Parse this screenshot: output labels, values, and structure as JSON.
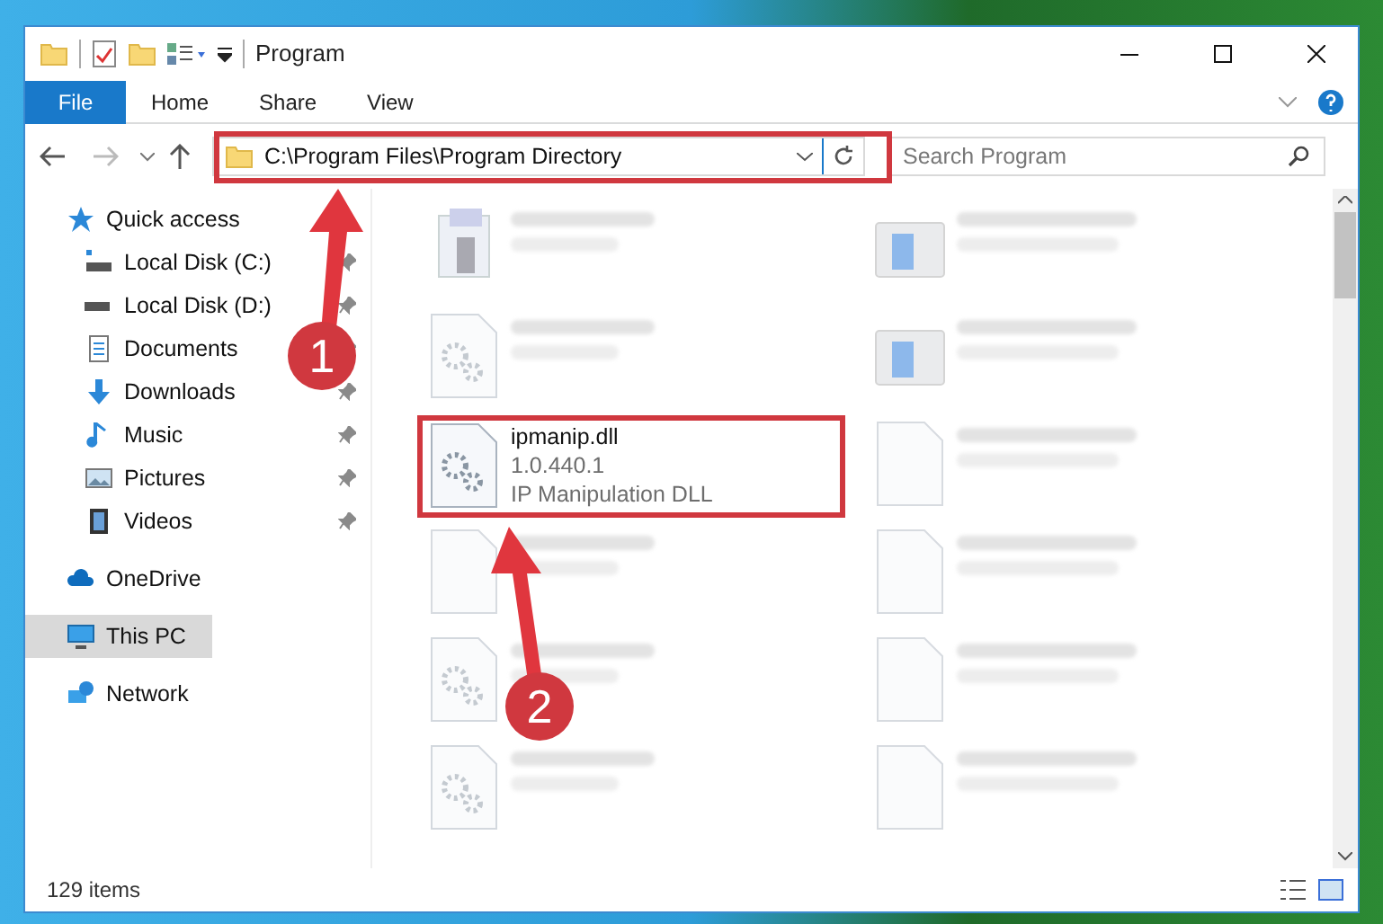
{
  "window": {
    "title": "Program"
  },
  "ribbon_tabs": [
    {
      "label": "File",
      "selected": true
    },
    {
      "label": "Home",
      "selected": false
    },
    {
      "label": "Share",
      "selected": false
    },
    {
      "label": "View",
      "selected": false
    }
  ],
  "address": {
    "path": "C:\\Program Files\\Program Directory"
  },
  "search": {
    "placeholder": "Search Program"
  },
  "sidebar": {
    "items": [
      {
        "label": "Quick access",
        "kind": "star",
        "selected": false,
        "children": [
          {
            "label": "Local Disk (C:)",
            "kind": "disk-c",
            "pinned": true,
            "selected": false
          },
          {
            "label": "Local Disk (D:)",
            "kind": "disk",
            "pinned": true,
            "selected": false
          },
          {
            "label": "Documents",
            "kind": "doc",
            "pinned": true,
            "selected": false
          },
          {
            "label": "Downloads",
            "kind": "down",
            "pinned": true,
            "selected": false
          },
          {
            "label": "Music",
            "kind": "music",
            "pinned": true,
            "selected": false
          },
          {
            "label": "Pictures",
            "kind": "pic",
            "pinned": true,
            "selected": false
          },
          {
            "label": "Videos",
            "kind": "video",
            "pinned": true,
            "selected": false
          }
        ]
      },
      {
        "label": "OneDrive",
        "kind": "cloud",
        "selected": false
      },
      {
        "label": "This PC",
        "kind": "pc",
        "selected": true
      },
      {
        "label": "Network",
        "kind": "net",
        "selected": false
      }
    ]
  },
  "files": [
    {
      "kind": "exe",
      "blurred": true
    },
    {
      "kind": "app",
      "blurred": true
    },
    {
      "kind": "dll",
      "blurred": true
    },
    {
      "kind": "app",
      "blurred": true
    },
    {
      "name": "ipmanip.dll",
      "lines": [
        "1.0.440.1",
        "IP Manipulation DLL"
      ],
      "kind": "dll",
      "blurred": false,
      "highlighted": true
    },
    {
      "kind": "file",
      "blurred": true
    },
    {
      "kind": "file",
      "blurred": true
    },
    {
      "kind": "file",
      "blurred": true
    },
    {
      "kind": "dll",
      "blurred": true
    },
    {
      "kind": "file",
      "blurred": true
    },
    {
      "kind": "dll",
      "blurred": true
    },
    {
      "kind": "file",
      "blurred": true
    }
  ],
  "status_bar": {
    "count": "129 items"
  },
  "annotations": [
    {
      "number": "1"
    },
    {
      "number": "2"
    }
  ]
}
